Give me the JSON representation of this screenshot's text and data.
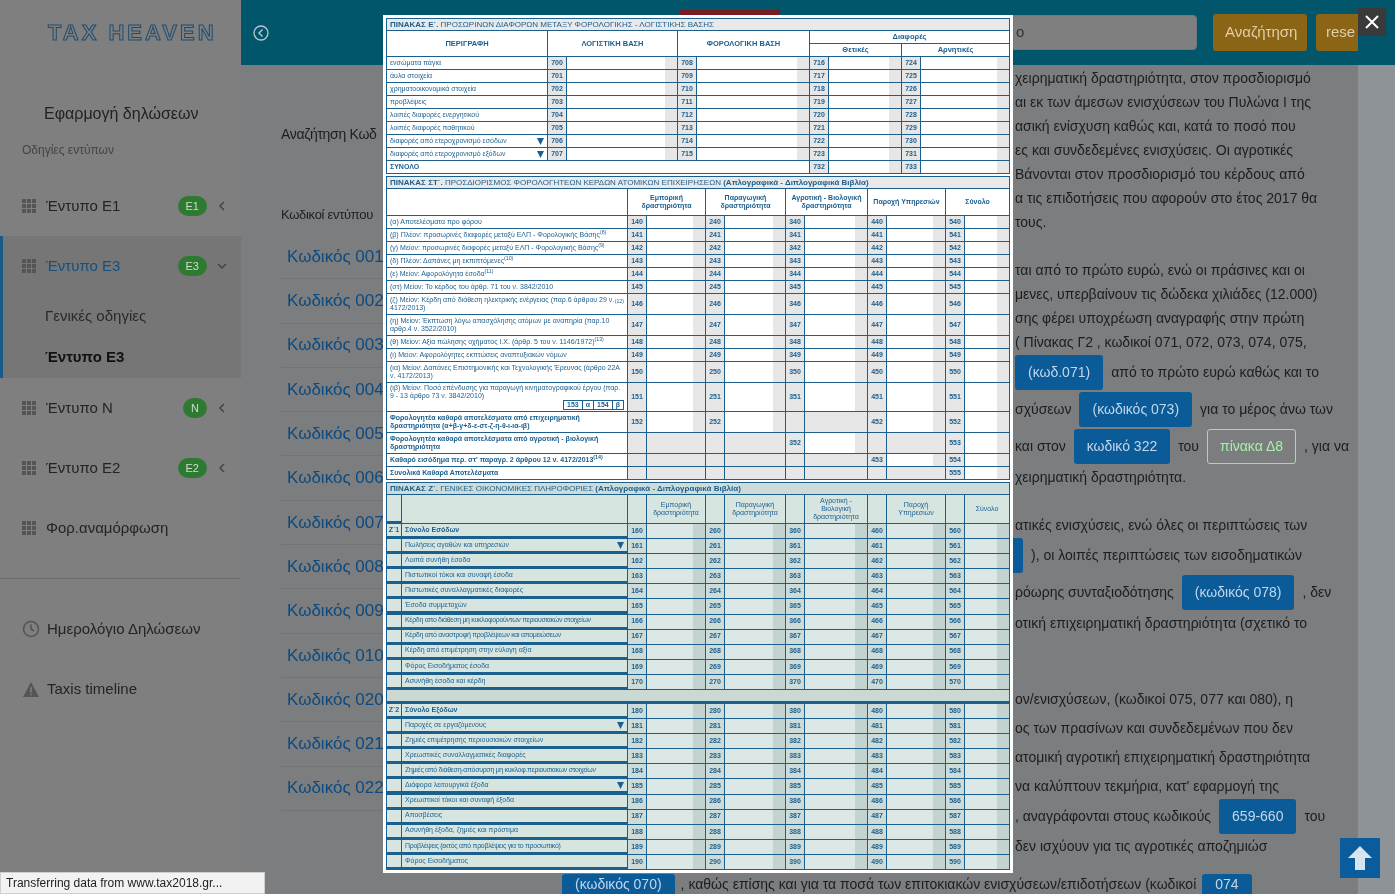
{
  "sidebar": {
    "logo": "TAX HEAVEN",
    "app_title": "Εφαρμογή δηλώσεων",
    "section_label": "Οδηγίες εντύπων",
    "items": [
      {
        "label": "Έντυπο Ε1",
        "badge": "E1",
        "expanded": false,
        "selected": false
      },
      {
        "label": "Έντυπο Ε3",
        "badge": "E3",
        "expanded": true,
        "selected": true,
        "children": [
          {
            "label": "Γενικές οδηγίες",
            "selected": false
          },
          {
            "label": "Έντυπο Ε3",
            "selected": true
          }
        ]
      },
      {
        "label": "Έντυπο Ν",
        "badge": "N",
        "expanded": false,
        "selected": false
      },
      {
        "label": "Έντυπο Ε2",
        "badge": "E2",
        "expanded": false,
        "selected": false
      },
      {
        "label": "Φορ.αναμόρφωση",
        "selected": false
      }
    ],
    "bottom_items": [
      {
        "label": "Ημερολόγιο Δηλώσεων"
      },
      {
        "label": "Taxis timeline"
      }
    ]
  },
  "topbar": {
    "search": {
      "value": "ο"
    },
    "buttons": [
      "Αναζήτηση",
      "rese"
    ]
  },
  "codes_panel": {
    "search_label": "Αναζήτηση Κωδ",
    "list_title": "Κωδικοί εντύπου",
    "links": [
      "Κωδικός 001",
      "Κωδικός 002",
      "Κωδικός 003",
      "Κωδικός 004",
      "Κωδικός 005",
      "Κωδικός 006",
      "Κωδικός 007",
      "Κωδικός 008",
      "Κωδικός 009",
      "Κωδικός 010",
      "Κωδικός 020",
      "Κωδικός 021",
      "Κωδικός 022"
    ]
  },
  "article": {
    "paragraphs": [
      {
        "lines": [
          [
            {
              "kind": "text",
              "text": "χειρηματική δραστηριότητα, στον προσδιορισμό"
            }
          ],
          [
            {
              "kind": "text",
              "text": "αι εκ των άμεσων ενισχύσεων του Πυλώνα Ι της"
            }
          ],
          [
            {
              "kind": "text",
              "text": "ασική ενίσχυση καθώς και, κατά το ποσό που"
            }
          ],
          [
            {
              "kind": "text",
              "text": "ες και συνδεδεμένες ενισχύσεις. Οι αγροτικές"
            }
          ],
          [
            {
              "kind": "text",
              "text": "Βάνονται στον προσδιορισμό του κέρδους από"
            }
          ],
          [
            {
              "kind": "text",
              "text": "α τις επιδοτήσεις που αφορούν στο έτος 2017 θα"
            }
          ],
          [
            {
              "kind": "text",
              "text": "τους."
            }
          ]
        ]
      },
      {
        "lines": [
          [
            {
              "kind": "text",
              "text": "ται από το πρώτο ευρώ, ενώ οι πράσινες και οι"
            }
          ],
          [
            {
              "kind": "text",
              "text": "μενες, υπερβαίνουν τις δώδεκα χιλιάδες (12.000)"
            }
          ],
          [
            {
              "kind": "text",
              "text": "σης φέρει υποχρέωση αναγραφής στην πρώτη"
            }
          ],
          [
            {
              "kind": "text",
              "text": "( Πίνακας Γ2 , κωδικοί 071, 072, 073, 074, 075,"
            }
          ],
          [
            {
              "kind": "badge",
              "text": "(κωδ.071)"
            },
            {
              "kind": "text",
              "text": "από το πρώτο ευρώ καθώς και το"
            }
          ],
          [
            {
              "kind": "text",
              "text": "σχύσεων"
            },
            {
              "kind": "badge",
              "text": "(κωδικός 073)"
            },
            {
              "kind": "text",
              "text": "για το μέρος άνω των"
            }
          ],
          [
            {
              "kind": "text",
              "text": "και στον"
            },
            {
              "kind": "badge",
              "text": "κωδικό 322"
            },
            {
              "kind": "text",
              "text": "του"
            },
            {
              "kind": "outline",
              "text": "πίνακα Δ8"
            },
            {
              "kind": "text",
              "text": ", για να"
            }
          ],
          [
            {
              "kind": "text",
              "text": "χειρηματική δραστηριότητα."
            }
          ]
        ]
      },
      {
        "lines": [
          [
            {
              "kind": "text",
              "text": "ατικές ενισχύσεις, ενώ όλες οι περιπτώσεις των"
            }
          ],
          [
            {
              "kind": "stub"
            },
            {
              "kind": "text",
              "text": "), οι λοιπές περιπτώσεις των εισοδηματικών"
            }
          ],
          [
            {
              "kind": "text",
              "text": "ρόωρης συνταξιοδότησης"
            },
            {
              "kind": "badge",
              "text": "(κωδικός 078)"
            },
            {
              "kind": "text",
              "text": ", δεν"
            }
          ],
          [
            {
              "kind": "text",
              "text": "οτική επιχειρηματική δραστηριότητα (σχετικό το"
            }
          ]
        ]
      },
      {
        "lines": [
          [
            {
              "kind": "text",
              "text": "ον/ενισχύσεων, (κωδικοί 075, 077 και 080), η"
            }
          ],
          [
            {
              "kind": "text",
              "text": "ος των πρασίνων και συνδεδεμένων που δεν"
            }
          ],
          [
            {
              "kind": "text",
              "text": "ατομική αγροτική επιχειρηματική δραστηριότητα"
            }
          ],
          [
            {
              "kind": "text",
              "text": "να καλύπτουν τεκμήρια, κατ' εφαρμογή της"
            }
          ],
          [
            {
              "kind": "text",
              "text": ", αναγράφονται στους κωδικούς"
            },
            {
              "kind": "badge",
              "text": "659-660"
            },
            {
              "kind": "text",
              "text": "του"
            }
          ],
          [
            {
              "kind": "text",
              "text": "δεν ισχύουν για τις αγροτικές αποζημιώσ"
            }
          ]
        ]
      }
    ],
    "last_line": [
      {
        "kind": "badge",
        "text": "(κωδικός 070)"
      },
      {
        "kind": "text",
        "text": ", καθώς επίσης και για τα ποσά των επιτοκιακών ενισχύσεων/επιδοτήσεων (κωδικοί"
      },
      {
        "kind": "badge",
        "text": "074"
      }
    ]
  },
  "form": {
    "table_e": {
      "title": "**ΠΙΝΑΚΑΣ Ε΄.** ΠΡΟΣΩΡΙΝΩΝ ΔΙΑΦΟΡΩΝ ΜΕΤΑΞΥ ΦΟΡΟΛΟΓΙΚΗΣ - ΛΟΓΙΣΤΙΚΗΣ ΒΑΣΗΣ",
      "headers": [
        "ΠΕΡΙΓΡΑΦΗ",
        "ΛΟΓΙΣΤΙΚΗ ΒΑΣΗ",
        "ΦΟΡΟΛΟΓΙΚΗ ΒΑΣΗ"
      ],
      "group_header": "Διαφορές",
      "sub_headers": [
        "Θετικές",
        "Αρνητικές"
      ],
      "rows": [
        {
          "label": "ενσώματα πάγια",
          "codes": [
            "700",
            "708",
            "716",
            "724"
          ]
        },
        {
          "label": "άυλα στοιχεία",
          "codes": [
            "701",
            "709",
            "717",
            "725"
          ]
        },
        {
          "label": "χρηματοοικονομικά στοιχεία",
          "codes": [
            "702",
            "710",
            "718",
            "726"
          ]
        },
        {
          "label": "προβλέψεις",
          "codes": [
            "703",
            "711",
            "719",
            "727"
          ]
        },
        {
          "label": "λοιπές διαφορές ενεργητικού",
          "codes": [
            "704",
            "712",
            "720",
            "728"
          ]
        },
        {
          "label": "λοιπές διαφορές παθητικού",
          "codes": [
            "705",
            "713",
            "721",
            "729"
          ]
        },
        {
          "label": "διαφορές από ετεροχρονισμό εσόδων",
          "arrow": true,
          "codes": [
            "706",
            "714",
            "722",
            "730"
          ]
        },
        {
          "label": "διαφορές από ετεροχρονισμό εξόδων",
          "arrow": true,
          "codes": [
            "707",
            "715",
            "723",
            "731"
          ]
        }
      ],
      "total": {
        "label": "ΣΥΝΟΛΟ",
        "codes": [
          "732",
          "733"
        ]
      }
    },
    "table_st": {
      "title": "**ΠΙΝΑΚΑΣ ΣΤ΄.** ΠΡΟΣΔΙΟΡΙΣΜΟΣ ΦΟΡΟΛΟΓΗΤΕΩΝ ΚΕΡΔΩΝ ΑΤΟΜΙΚΩΝ ΕΠΙΧΕΙΡΗΣΕΩΝ **(Απλογραφικά - Διπλογραφικά Βιβλία)**",
      "columns": [
        "Εμπορική δραστηριότητα",
        "Παραγωγική δραστηριότητα",
        "Αγροτική - Βιολογική δραστηριότητα",
        "Παροχή Υπηρεσιών",
        "Σύνολο"
      ],
      "rows": [
        {
          "kind": "item",
          "label": "(α) Αποτελέσματα προ φόρου",
          "codes": {
            "col_1": "140",
            "col_2": "240",
            "col_3": "340",
            "col_4": "440",
            "col_5": "540"
          }
        },
        {
          "kind": "item",
          "label": "(β) Πλέον: προσωρινές διαφορές μεταξύ ΕΛΠ - Φορολογικής Βάσης$^{(8)}$",
          "codes": {
            "col_1": "141",
            "col_2": "241",
            "col_3": "341",
            "col_4": "441",
            "col_5": "541"
          }
        },
        {
          "kind": "item",
          "label": "(γ) Μείον: προσωρινές διαφορές μεταξύ ΕΛΠ - Φορολογικής Βάσης$^{(9)}$",
          "codes": {
            "col_1": "142",
            "col_2": "242",
            "col_3": "342",
            "col_4": "442",
            "col_5": "542"
          }
        },
        {
          "kind": "item",
          "label": "(δ) Πλέον: Δαπάνες μη εκπιπτόμενες$^{(10)}$",
          "codes": {
            "col_1": "143",
            "col_2": "243",
            "col_3": "343",
            "col_4": "443",
            "col_5": "543"
          }
        },
        {
          "kind": "item",
          "label": "(ε) Μείον: Αφορολόγητα έσοδα$^{(11)}$",
          "codes": {
            "col_1": "144",
            "col_2": "244",
            "col_3": "344",
            "col_4": "444",
            "col_5": "544"
          }
        },
        {
          "kind": "item",
          "label": "(στ) Μείον: Το κέρδος του άρθρ. 71 του ν. 3842/2010",
          "codes": {
            "col_1": "145",
            "col_2": "245",
            "col_3": "345",
            "col_4": "445",
            "col_5": "545"
          }
        },
        {
          "kind": "item",
          "label": "(ζ) Μείον: Κέρδη από διάθεση ηλεκτρικής ενέργειας (παρ.6 άρθρου 29 ν. 4172/2013)$^{(12)}$",
          "codes": {
            "col_1": "146",
            "col_2": "246",
            "col_3": "346",
            "col_4": "446",
            "col_5": "546"
          }
        },
        {
          "kind": "item",
          "label": "(η) Μείον: Έκπτωση λόγω απασχόλησης ατόμων με αναπηρία (παρ.10 αρθρ.4 ν. 3522/2010)",
          "codes": {
            "col_1": "147",
            "col_2": "247",
            "col_3": "347",
            "col_4": "447",
            "col_5": "547"
          }
        },
        {
          "kind": "item",
          "label": "(θ) Μείον: Αξία πώλησης οχήματος Ι.Χ. (άρθρ. 5 του ν. 1146/1972)$^{(13)}$",
          "codes": {
            "col_1": "148",
            "col_2": "248",
            "col_3": "348",
            "col_4": "448",
            "col_5": "548"
          }
        },
        {
          "kind": "item",
          "label": "(ι) Μείον: Αφορολόγητες εκπτώσεις αναπτυξιακών νόμων",
          "codes": {
            "col_1": "149",
            "col_2": "249",
            "col_3": "349",
            "col_4": "449",
            "col_5": "549"
          }
        },
        {
          "kind": "item",
          "label": "(ια) Μείον: Δαπάνες Επιστημονικής και Τεχνολογικής Έρευνας (άρθρο 22Α ν. 4172/2013)",
          "codes": {
            "col_1": "150",
            "col_2": "250",
            "col_3": "350",
            "col_4": "450",
            "col_5": "550"
          }
        },
        {
          "kind": "item",
          "label": "(ιβ) Μείον: Ποσό επένδυσης για παραγωγή κινηματογραφικού έργου (παρ. 9 - 13 άρθρο 73 ν. 3842/2010)",
          "subcodes": [
            "153",
            "α",
            "154",
            "β"
          ],
          "codes": {
            "col_1": "151",
            "col_2": "251",
            "col_3": "351",
            "col_4": "451",
            "col_5": "551"
          }
        },
        {
          "kind": "total",
          "label": "Φορολογητέα καθαρά αποτελέσματα από επιχειρηματική δραστηριότητα (α+β-γ+δ-ε-στ-ζ-η-θ-ι-ια-ιβ)",
          "codes": {
            "col_1": "152",
            "col_2": "252",
            "col_4": "452",
            "col_5": "552"
          }
        },
        {
          "kind": "total",
          "label": "Φορολογητέα καθαρά αποτελέσματα από αγροτική - βιολογική δραστηριότητα",
          "codes": {
            "col_3": "352",
            "col_5": "553"
          }
        },
        {
          "kind": "total",
          "label": "Καθαρό εισόδημα περ. στ' παραγρ. 2 άρθρου 12 ν. 4172/2013$^{(14)}$",
          "codes": {
            "col_4": "453",
            "col_5": "554"
          }
        },
        {
          "kind": "total",
          "label": "Συνολικά Καθαρά Αποτελέσματα",
          "codes": {
            "col_5": "555"
          }
        }
      ]
    },
    "table_z": {
      "title": "**ΠΙΝΑΚΑΣ Ζ΄.** ΓΕΝΙΚΕΣ ΟΙΚΟΝΟΜΙΚΕΣ ΠΛΗΡΟΦΟΡΙΕΣ **(Απλογραφικά - Διπλογραφικά Βιβλία)**",
      "columns": [
        "Εμπορική δραστηριότητα",
        "Παραγωγική δραστηριότητα",
        "Αγροτική - Βιολογική δραστηριότητα",
        "Παροχή Υπηρεσιών",
        "Σύνολο"
      ],
      "sections": [
        {
          "label": "Ζ΄1",
          "rows": [
            {
              "kind": "total",
              "label": "Σύνολο Εσόδων",
              "codes": [
                "160",
                "260",
                "360",
                "460",
                "560"
              ]
            },
            {
              "kind": "item",
              "label": "Πωλήσεις αγαθών και υπηρεσιών",
              "arrow": true,
              "codes": [
                "161",
                "261",
                "361",
                "461",
                "561"
              ]
            },
            {
              "kind": "item",
              "label": "Λοιπά συνήθη έσοδα",
              "codes": [
                "162",
                "262",
                "362",
                "462",
                "562"
              ]
            },
            {
              "kind": "item",
              "label": "Πιστωτικοί τόκοι και συναφή έσοδα",
              "codes": [
                "163",
                "263",
                "363",
                "463",
                "563"
              ]
            },
            {
              "kind": "item",
              "label": "Πιστωτικές συναλλαγματικές διαφορές",
              "codes": [
                "164",
                "264",
                "364",
                "464",
                "564"
              ]
            },
            {
              "kind": "item",
              "label": "Έσοδα συμμετοχών",
              "codes": [
                "165",
                "265",
                "365",
                "465",
                "565"
              ]
            },
            {
              "kind": "item",
              "label": "Κέρδη απο διάθεση μη κυκλοφορούντων περιουσιακών στοιχείων",
              "codes": [
                "166",
                "266",
                "366",
                "466",
                "566"
              ]
            },
            {
              "kind": "item",
              "label": "Κέρδη από αναστροφή προβλέψεων και απομειώσεων",
              "codes": [
                "167",
                "267",
                "367",
                "467",
                "567"
              ]
            },
            {
              "kind": "item",
              "label": "Κέρδη από επιμέτρηση στην εύλογη αξία",
              "codes": [
                "168",
                "268",
                "368",
                "468",
                "568"
              ]
            },
            {
              "kind": "item",
              "label": "Φόρος Εισοδήματος έσοδα",
              "codes": [
                "169",
                "269",
                "369",
                "469",
                "569"
              ]
            },
            {
              "kind": "item",
              "label": "Ασυνήθη έσοδα και κέρδη",
              "codes": [
                "170",
                "270",
                "370",
                "470",
                "570"
              ]
            }
          ]
        },
        {
          "label": "Ζ΄2",
          "rows": [
            {
              "kind": "total",
              "label": "Σύνολο Εξόδων",
              "codes": [
                "180",
                "280",
                "380",
                "480",
                "580"
              ]
            },
            {
              "kind": "item",
              "label": "Παροχές σε εργαζόμενους",
              "arrow": true,
              "codes": [
                "181",
                "281",
                "381",
                "481",
                "581"
              ]
            },
            {
              "kind": "item",
              "label": "Ζημιές επιμέτρησης περιουσιακών στοιχείων",
              "codes": [
                "182",
                "282",
                "382",
                "482",
                "582"
              ]
            },
            {
              "kind": "item",
              "label": "Χρεωστικές συναλλαγματικές διαφορές",
              "codes": [
                "183",
                "283",
                "383",
                "483",
                "583"
              ]
            },
            {
              "kind": "item",
              "label": "Ζημιές από διάθεση-απόσυρση μη κυκλοφ.περιουσιακων στοιχείων",
              "codes": [
                "184",
                "284",
                "384",
                "484",
                "584"
              ]
            },
            {
              "kind": "item",
              "label": "Διάφορα λειτουργικά έξοδα",
              "arrow": true,
              "codes": [
                "185",
                "285",
                "385",
                "485",
                "585"
              ]
            },
            {
              "kind": "item",
              "label": "Χρεωστικοί τόκοι και συναφή έξοδα",
              "codes": [
                "186",
                "286",
                "386",
                "486",
                "586"
              ]
            },
            {
              "kind": "item",
              "label": "Αποσβέσεις",
              "codes": [
                "187",
                "287",
                "387",
                "487",
                "587"
              ]
            },
            {
              "kind": "item",
              "label": "Ασυνήθη έξοδα, ζημιές και πρόστιμα",
              "codes": [
                "188",
                "288",
                "388",
                "488",
                "588"
              ]
            },
            {
              "kind": "item",
              "label": "Προβλέψεις (εκτός από προβλέψεις για το προσωπικό)",
              "codes": [
                "189",
                "289",
                "389",
                "489",
                "589"
              ]
            },
            {
              "kind": "item",
              "label": "Φόρος Εισοδήματος",
              "codes": [
                "190",
                "290",
                "390",
                "490",
                "590"
              ]
            }
          ]
        }
      ]
    }
  },
  "status_bar": "Transferring data from www.tax2018.gr..."
}
